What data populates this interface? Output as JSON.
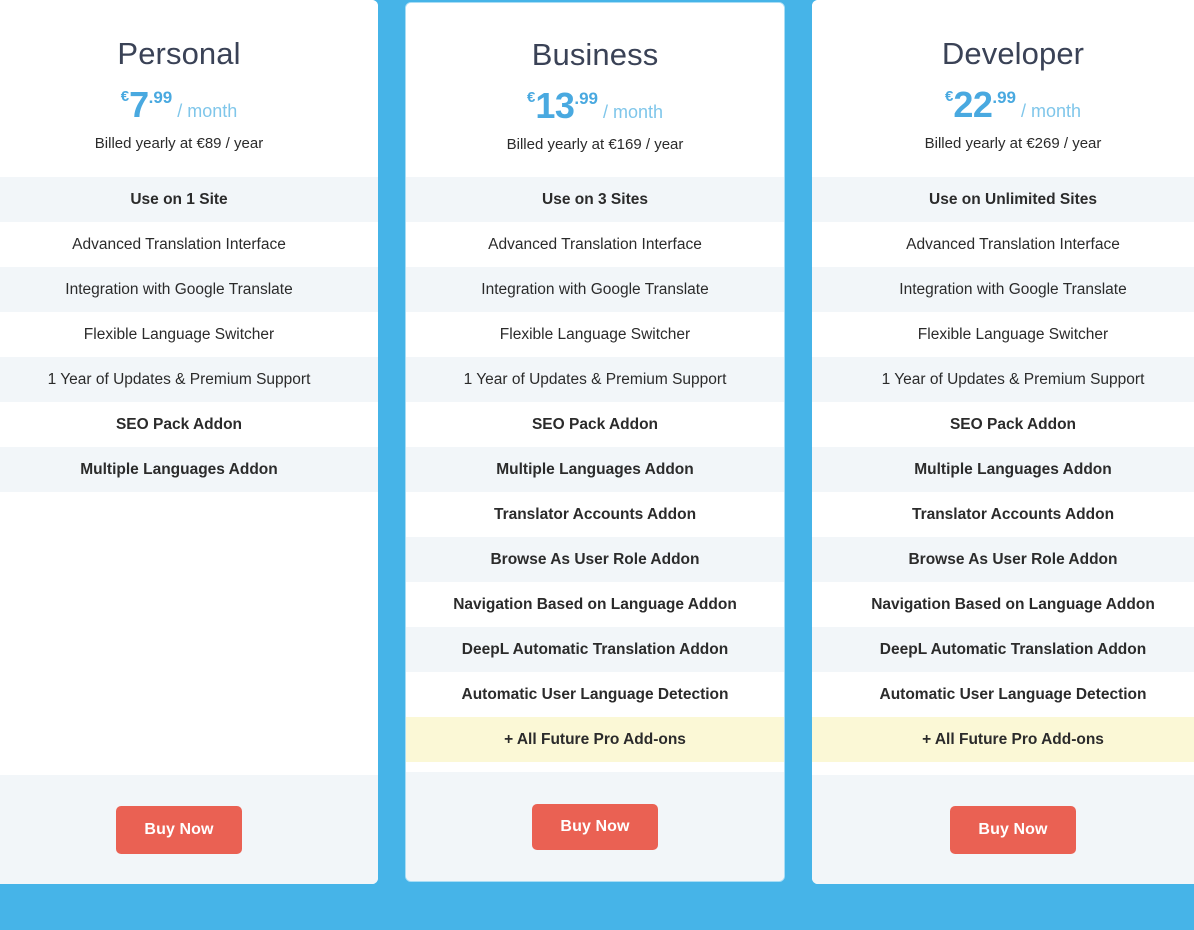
{
  "theme": {
    "background_blue": "#46b4e8",
    "accent_blue": "#49a9e0",
    "period_blue": "#7fc6ea",
    "buy_button_color": "#ea6153",
    "row_alt_color": "#f2f6f9",
    "future_row_color": "#fbf8d6",
    "heading_color": "#3a4256"
  },
  "plans": [
    {
      "name": "Personal",
      "currency": "€",
      "amount": "7",
      "cents": ".99",
      "period": "/ month",
      "billed_note": "Billed yearly at €89 / year",
      "buy_label": "Buy Now",
      "features": [
        {
          "label": "Use on 1 Site",
          "bold": true,
          "style": "alt"
        },
        {
          "label": "Advanced Translation Interface",
          "bold": false,
          "style": "plain"
        },
        {
          "label": "Integration with Google Translate",
          "bold": false,
          "style": "alt"
        },
        {
          "label": "Flexible Language Switcher",
          "bold": false,
          "style": "plain"
        },
        {
          "label": "1 Year of Updates & Premium Support",
          "bold": false,
          "style": "alt"
        },
        {
          "label": "SEO Pack Addon",
          "bold": true,
          "style": "plain"
        },
        {
          "label": "Multiple Languages Addon",
          "bold": true,
          "style": "alt"
        }
      ]
    },
    {
      "name": "Business",
      "currency": "€",
      "amount": "13",
      "cents": ".99",
      "period": "/ month",
      "billed_note": "Billed yearly at €169 / year",
      "buy_label": "Buy Now",
      "features": [
        {
          "label": "Use on 3 Sites",
          "bold": true,
          "style": "alt"
        },
        {
          "label": "Advanced Translation Interface",
          "bold": false,
          "style": "plain"
        },
        {
          "label": "Integration with Google Translate",
          "bold": false,
          "style": "alt"
        },
        {
          "label": "Flexible Language Switcher",
          "bold": false,
          "style": "plain"
        },
        {
          "label": "1 Year of Updates & Premium Support",
          "bold": false,
          "style": "alt"
        },
        {
          "label": "SEO Pack Addon",
          "bold": true,
          "style": "plain"
        },
        {
          "label": "Multiple Languages Addon",
          "bold": true,
          "style": "alt"
        },
        {
          "label": "Translator Accounts Addon",
          "bold": true,
          "style": "plain"
        },
        {
          "label": "Browse As User Role Addon",
          "bold": true,
          "style": "alt"
        },
        {
          "label": "Navigation Based on Language Addon",
          "bold": true,
          "style": "plain"
        },
        {
          "label": "DeepL Automatic Translation Addon",
          "bold": true,
          "style": "alt"
        },
        {
          "label": "Automatic User Language Detection",
          "bold": true,
          "style": "plain"
        },
        {
          "label": "+ All Future Pro Add-ons",
          "bold": true,
          "style": "future"
        }
      ]
    },
    {
      "name": "Developer",
      "currency": "€",
      "amount": "22",
      "cents": ".99",
      "period": "/ month",
      "billed_note": "Billed yearly at €269 / year",
      "buy_label": "Buy Now",
      "features": [
        {
          "label": "Use on Unlimited Sites",
          "bold": true,
          "style": "alt"
        },
        {
          "label": "Advanced Translation Interface",
          "bold": false,
          "style": "plain"
        },
        {
          "label": "Integration with Google Translate",
          "bold": false,
          "style": "alt"
        },
        {
          "label": "Flexible Language Switcher",
          "bold": false,
          "style": "plain"
        },
        {
          "label": "1 Year of Updates & Premium Support",
          "bold": false,
          "style": "alt"
        },
        {
          "label": "SEO Pack Addon",
          "bold": true,
          "style": "plain"
        },
        {
          "label": "Multiple Languages Addon",
          "bold": true,
          "style": "alt"
        },
        {
          "label": "Translator Accounts Addon",
          "bold": true,
          "style": "plain"
        },
        {
          "label": "Browse As User Role Addon",
          "bold": true,
          "style": "alt"
        },
        {
          "label": "Navigation Based on Language Addon",
          "bold": true,
          "style": "plain"
        },
        {
          "label": "DeepL Automatic Translation Addon",
          "bold": true,
          "style": "alt"
        },
        {
          "label": "Automatic User Language Detection",
          "bold": true,
          "style": "plain"
        },
        {
          "label": "+ All Future Pro Add-ons",
          "bold": true,
          "style": "future"
        }
      ]
    }
  ]
}
